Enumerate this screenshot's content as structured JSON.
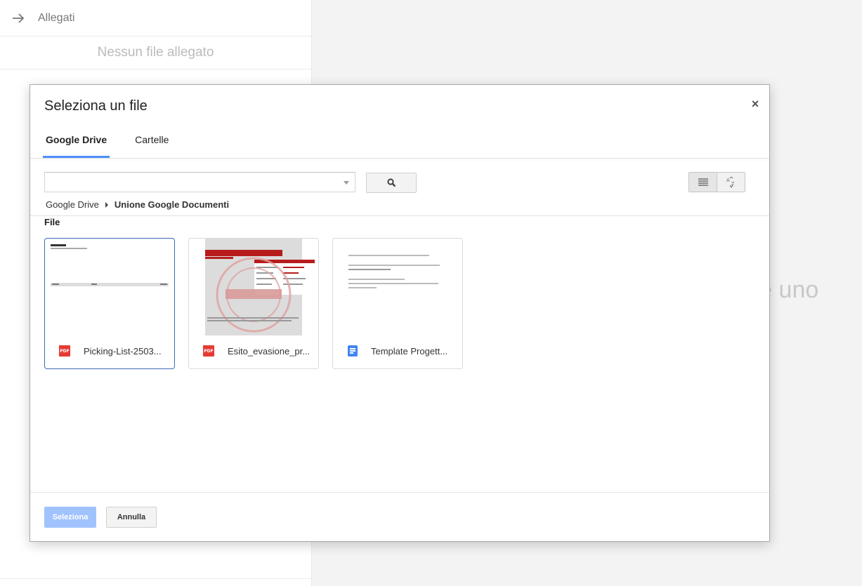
{
  "panel": {
    "title": "Allegati",
    "empty_text": "Nessun file allegato",
    "partial_text": "rire uno"
  },
  "dialog": {
    "title": "Seleziona un file",
    "close_glyph": "×",
    "tabs": [
      {
        "label": "Google Drive",
        "active": true
      },
      {
        "label": "Cartelle",
        "active": false
      }
    ],
    "search": {
      "value": "",
      "placeholder": ""
    },
    "breadcrumb": {
      "root": "Google Drive",
      "current": "Unione Google Documenti"
    },
    "section_label": "File",
    "files": [
      {
        "name": "Picking-List-2503...",
        "type": "pdf",
        "icon": "pdf-icon",
        "icon_text": "PDF",
        "selected": true
      },
      {
        "name": "Esito_evasione_pr...",
        "type": "pdf",
        "icon": "pdf-icon",
        "icon_text": "PDF",
        "selected": false
      },
      {
        "name": "Template Progett...",
        "type": "gdoc",
        "icon": "google-docs-icon",
        "selected": false
      }
    ],
    "buttons": {
      "select": "Seleziona",
      "cancel": "Annulla"
    }
  },
  "colors": {
    "accent": "#4d90fe",
    "primary_disabled": "#a0c3ff",
    "selected_border": "#3b6cb6",
    "pdf": "#e53935",
    "docs": "#4285f4"
  }
}
